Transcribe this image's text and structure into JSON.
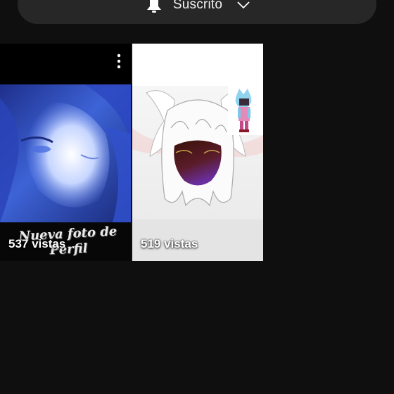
{
  "subscribe": {
    "label": "Suscrito",
    "bell_icon": "bell-icon",
    "chevron_icon": "chevron-down-icon"
  },
  "shorts": [
    {
      "views": "537 vistas",
      "overlay_text": "Nueva foto de Perfil",
      "menu_icon": "more-vertical-icon"
    },
    {
      "views": "519 vistas"
    }
  ],
  "colors": {
    "background": "#0f0f0f",
    "pill": "#272727",
    "text": "#ffffff"
  }
}
